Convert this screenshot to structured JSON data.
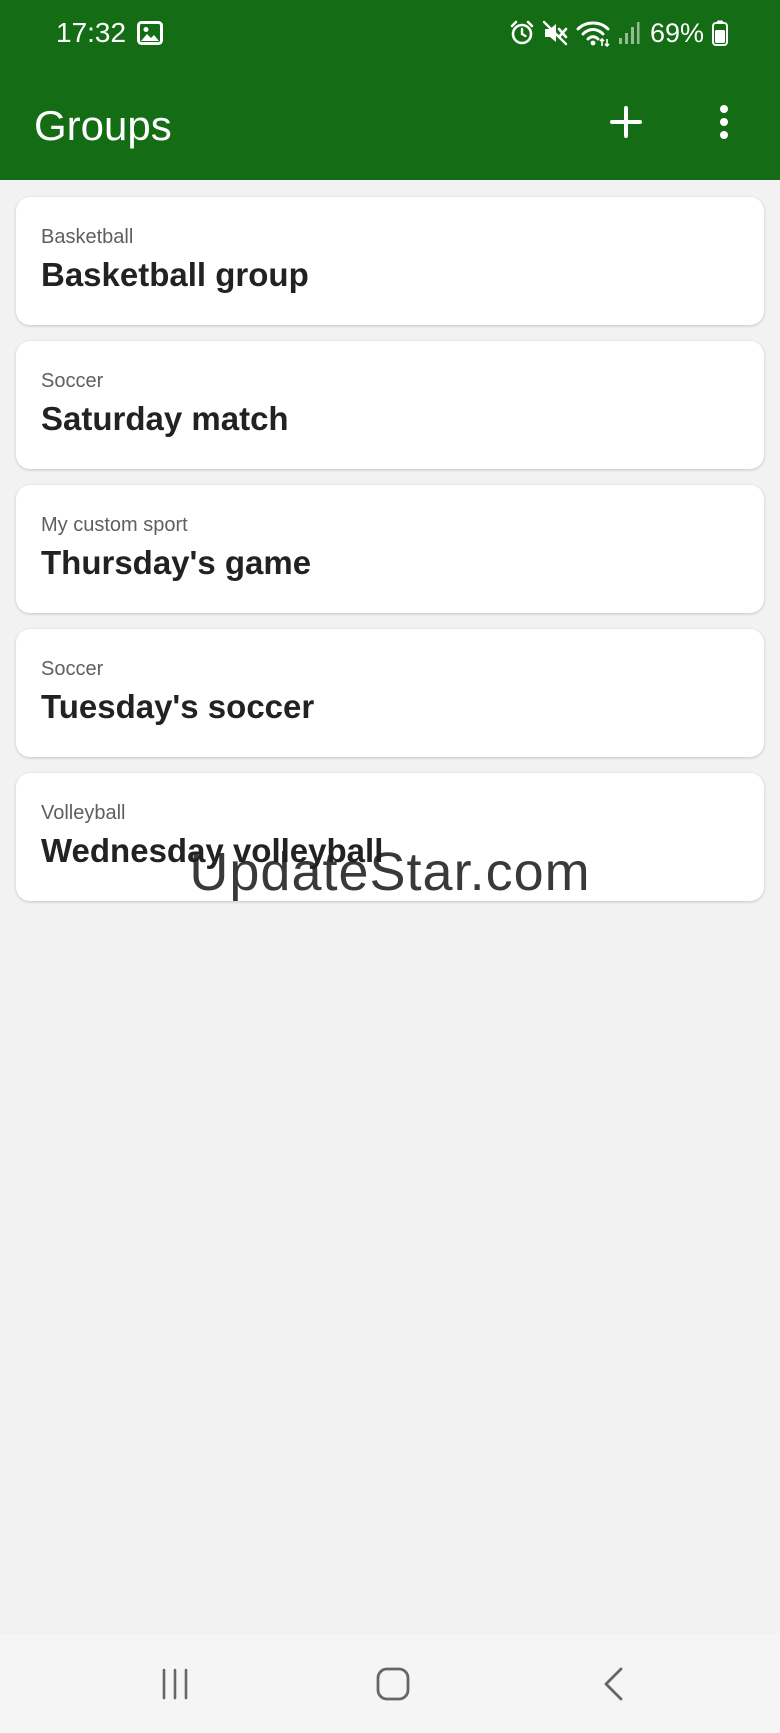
{
  "status_bar": {
    "time": "17:32",
    "battery_percent": "69%",
    "icons": [
      "gallery-icon",
      "alarm-icon",
      "mute-icon",
      "wifi-icon",
      "signal-icon",
      "battery-icon"
    ]
  },
  "app_bar": {
    "title": "Groups",
    "actions": [
      "add-icon",
      "more-vert-icon"
    ]
  },
  "groups": [
    {
      "sport": "Basketball",
      "name": "Basketball group"
    },
    {
      "sport": "Soccer",
      "name": "Saturday match"
    },
    {
      "sport": "My custom sport",
      "name": "Thursday's game"
    },
    {
      "sport": "Soccer",
      "name": "Tuesday's soccer"
    },
    {
      "sport": "Volleyball",
      "name": "Wednesday volleyball"
    }
  ],
  "watermark": "UpdateStar.com",
  "nav_bar": {
    "buttons": [
      "recents-icon",
      "home-icon",
      "back-icon"
    ]
  },
  "colors": {
    "primary": "#146c14",
    "background": "#f2f2f2",
    "card": "#ffffff",
    "text_primary": "#222222",
    "text_secondary": "#5f5f5f"
  }
}
